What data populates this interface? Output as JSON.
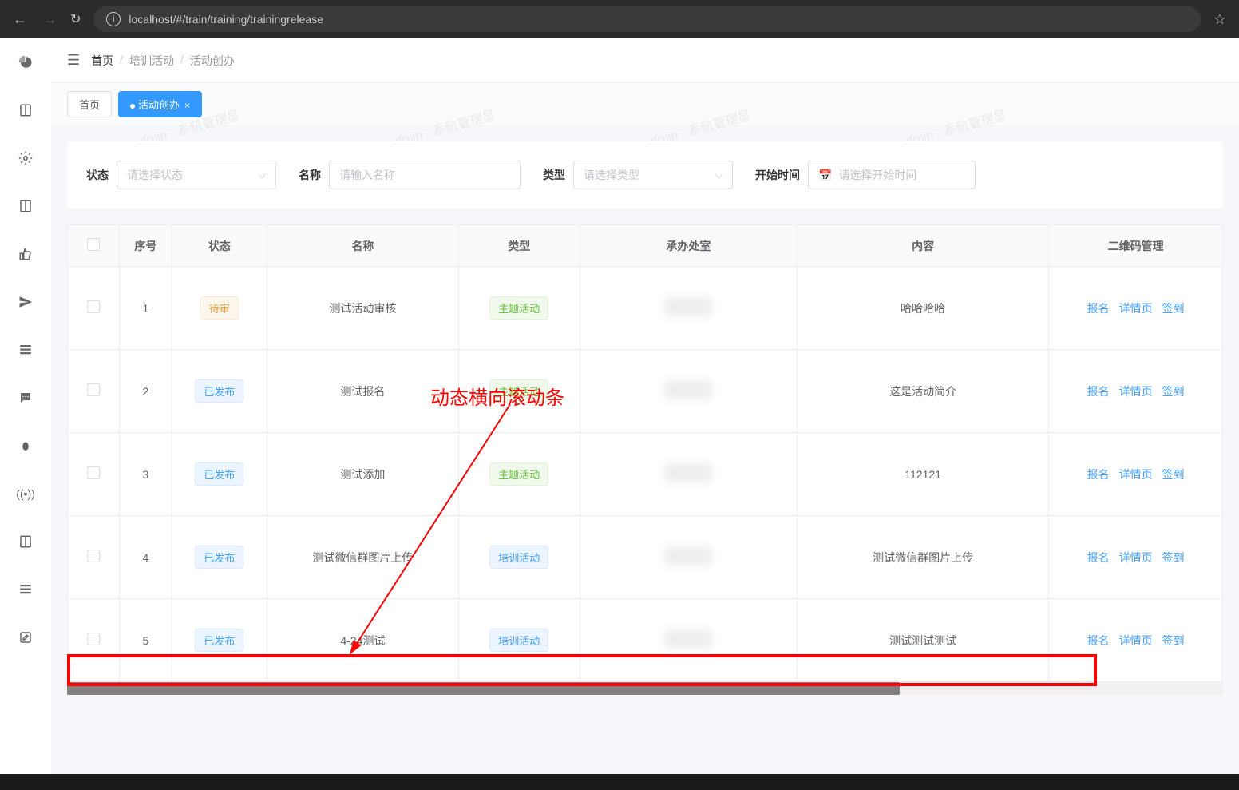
{
  "browser": {
    "url": "localhost/#/train/training/trainingrelease"
  },
  "breadcrumb": {
    "home": "首页",
    "level1": "培训活动",
    "level2": "活动创办"
  },
  "tabs": {
    "home": "首页",
    "active": "活动创办"
  },
  "filters": {
    "status_label": "状态",
    "status_placeholder": "请选择状态",
    "name_label": "名称",
    "name_placeholder": "请输入名称",
    "type_label": "类型",
    "type_placeholder": "请选择类型",
    "start_label": "开始时间",
    "start_placeholder": "请选择开始时间"
  },
  "table": {
    "headers": {
      "seq": "序号",
      "status": "状态",
      "name": "名称",
      "type": "类型",
      "dept": "承办处室",
      "content": "内容",
      "qr": "二维码管理"
    },
    "actions": {
      "signup": "报名",
      "detail": "详情页",
      "checkin": "签到"
    },
    "rows": [
      {
        "seq": "1",
        "status": "待审",
        "status_class": "pending",
        "name": "测试活动审核",
        "type": "主题活动",
        "type_class": "theme",
        "content": "哈哈哈哈"
      },
      {
        "seq": "2",
        "status": "已发布",
        "status_class": "published",
        "name": "测试报名",
        "type": "主题活动",
        "type_class": "theme",
        "content": "这是活动简介"
      },
      {
        "seq": "3",
        "status": "已发布",
        "status_class": "published",
        "name": "测试添加",
        "type": "主题活动",
        "type_class": "theme",
        "content": "112121"
      },
      {
        "seq": "4",
        "status": "已发布",
        "status_class": "published",
        "name": "测试微信群图片上传",
        "type": "培训活动",
        "type_class": "train",
        "content": "测试微信群图片上传"
      },
      {
        "seq": "5",
        "status": "已发布",
        "status_class": "published",
        "name": "4-24测试",
        "type": "培训活动",
        "type_class": "train",
        "content": "测试测试测试"
      }
    ]
  },
  "watermark": "admin - 系统管理员",
  "annotation": "动态横向滚动条"
}
